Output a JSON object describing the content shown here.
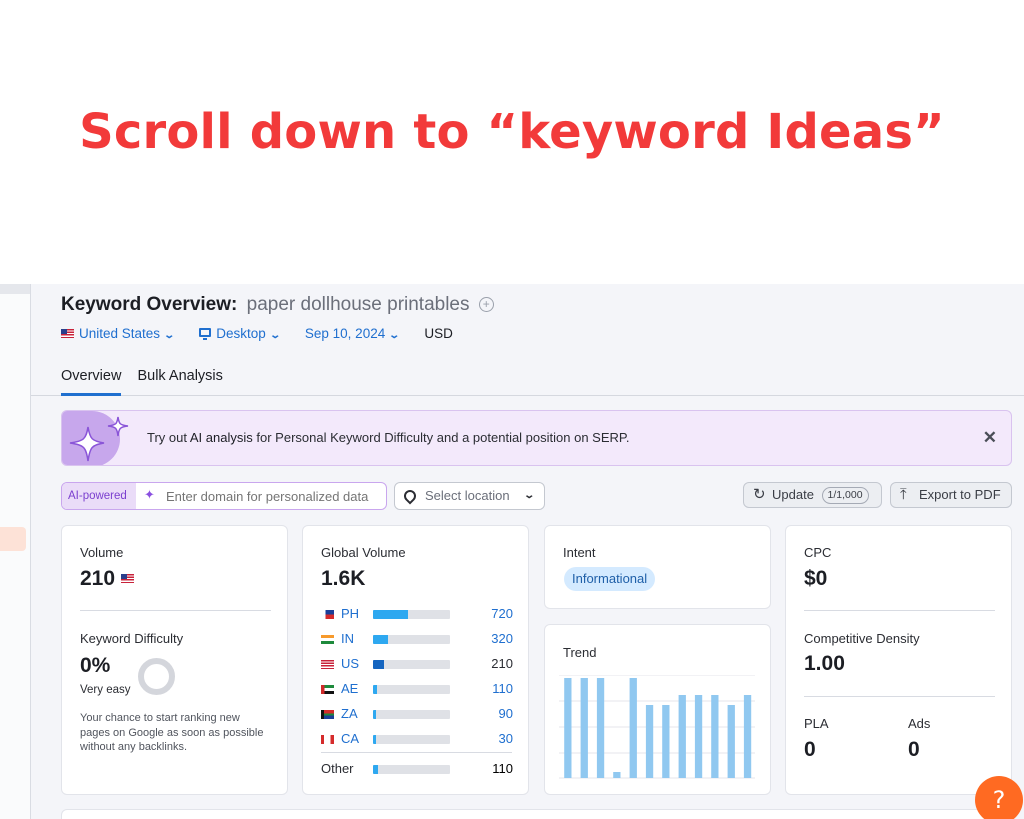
{
  "headline": "Scroll down to “keyword Ideas”",
  "header": {
    "title": "Keyword Overview:",
    "keyword": "paper dollhouse printables",
    "filters": {
      "country": "United States",
      "device": "Desktop",
      "date": "Sep 10, 2024",
      "currency": "USD"
    },
    "tabs": [
      {
        "label": "Overview",
        "active": true
      },
      {
        "label": "Bulk Analysis",
        "active": false
      }
    ]
  },
  "banner": {
    "prefix": "Try out",
    "link": "AI analysis",
    "suffix": "for Personal Keyword Difficulty and a potential position on SERP."
  },
  "toolbar": {
    "ai_tag": "AI-powered",
    "domain_placeholder": "Enter domain for personalized data",
    "location_placeholder": "Select location",
    "update_label": "Update",
    "update_count": "1/1,000",
    "export_label": "Export to PDF"
  },
  "volume": {
    "label": "Volume",
    "value": "210"
  },
  "difficulty": {
    "label": "Keyword Difficulty",
    "value": "0%",
    "rating": "Very easy",
    "percent": 0,
    "description": "Your chance to start ranking new pages on Google as soon as possible without any backlinks."
  },
  "global_volume": {
    "label": "Global Volume",
    "value": "1.6K",
    "rows": [
      {
        "code": "PH",
        "value": "720",
        "share": 0.46,
        "link": true
      },
      {
        "code": "IN",
        "value": "320",
        "share": 0.2,
        "link": true
      },
      {
        "code": "US",
        "value": "210",
        "share": 0.14,
        "link": false
      },
      {
        "code": "AE",
        "value": "110",
        "share": 0.05,
        "link": true
      },
      {
        "code": "ZA",
        "value": "90",
        "share": 0.04,
        "link": true
      },
      {
        "code": "CA",
        "value": "30",
        "share": 0.03,
        "link": true
      }
    ],
    "other": {
      "label": "Other",
      "value": "110",
      "share": 0.06
    }
  },
  "intent": {
    "label": "Intent",
    "value": "Informational"
  },
  "trend": {
    "label": "Trend",
    "values": [
      1.0,
      1.0,
      1.0,
      0.06,
      1.0,
      0.73,
      0.73,
      0.83,
      0.83,
      0.83,
      0.73,
      0.83
    ]
  },
  "cpc": {
    "label": "CPC",
    "value": "$0"
  },
  "competitive_density": {
    "label": "Competitive Density",
    "value": "1.00"
  },
  "pla": {
    "label": "PLA",
    "value": "0"
  },
  "ads": {
    "label": "Ads",
    "value": "0"
  },
  "help": {
    "label": "?"
  },
  "colors": {
    "headline": "#f23a3a",
    "link": "#1f6fcf",
    "bar_primary": "#2ea8f0",
    "bar_dark": "#1565c0",
    "trend_bar": "#90c8f0",
    "help_button": "#ff6a22"
  },
  "icons": [
    "us-flag-icon",
    "monitor-icon",
    "chevron-down-icon",
    "plus-circle-icon",
    "sparkle-icon",
    "close-icon",
    "location-pin-icon",
    "refresh-icon",
    "upload-icon",
    "question-icon"
  ]
}
